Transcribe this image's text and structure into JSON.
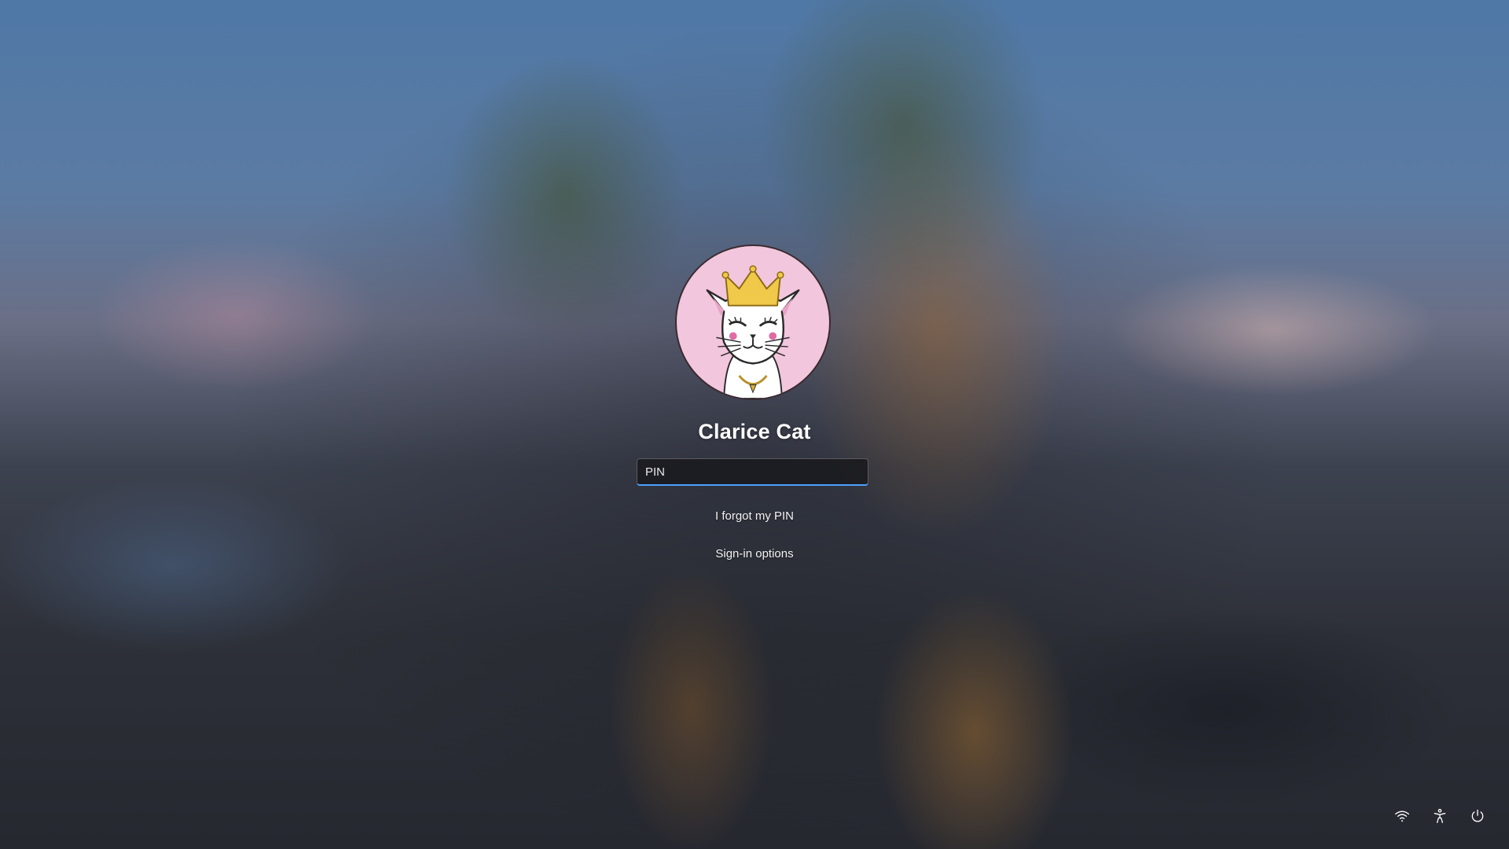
{
  "user": {
    "name": "Clarice Cat",
    "avatar_icon": "cat-with-crown-avatar"
  },
  "pin": {
    "placeholder": "PIN",
    "value": ""
  },
  "links": {
    "forgot_pin": "I forgot my PIN",
    "sign_in_options": "Sign-in options"
  },
  "tray": [
    {
      "name": "network",
      "icon": "wifi-icon"
    },
    {
      "name": "accessibility",
      "icon": "accessibility-icon"
    },
    {
      "name": "power",
      "icon": "power-icon"
    }
  ],
  "colors": {
    "accent": "#4da0ff",
    "avatar_bg": "#f2c6dc",
    "text": "#ffffff"
  }
}
